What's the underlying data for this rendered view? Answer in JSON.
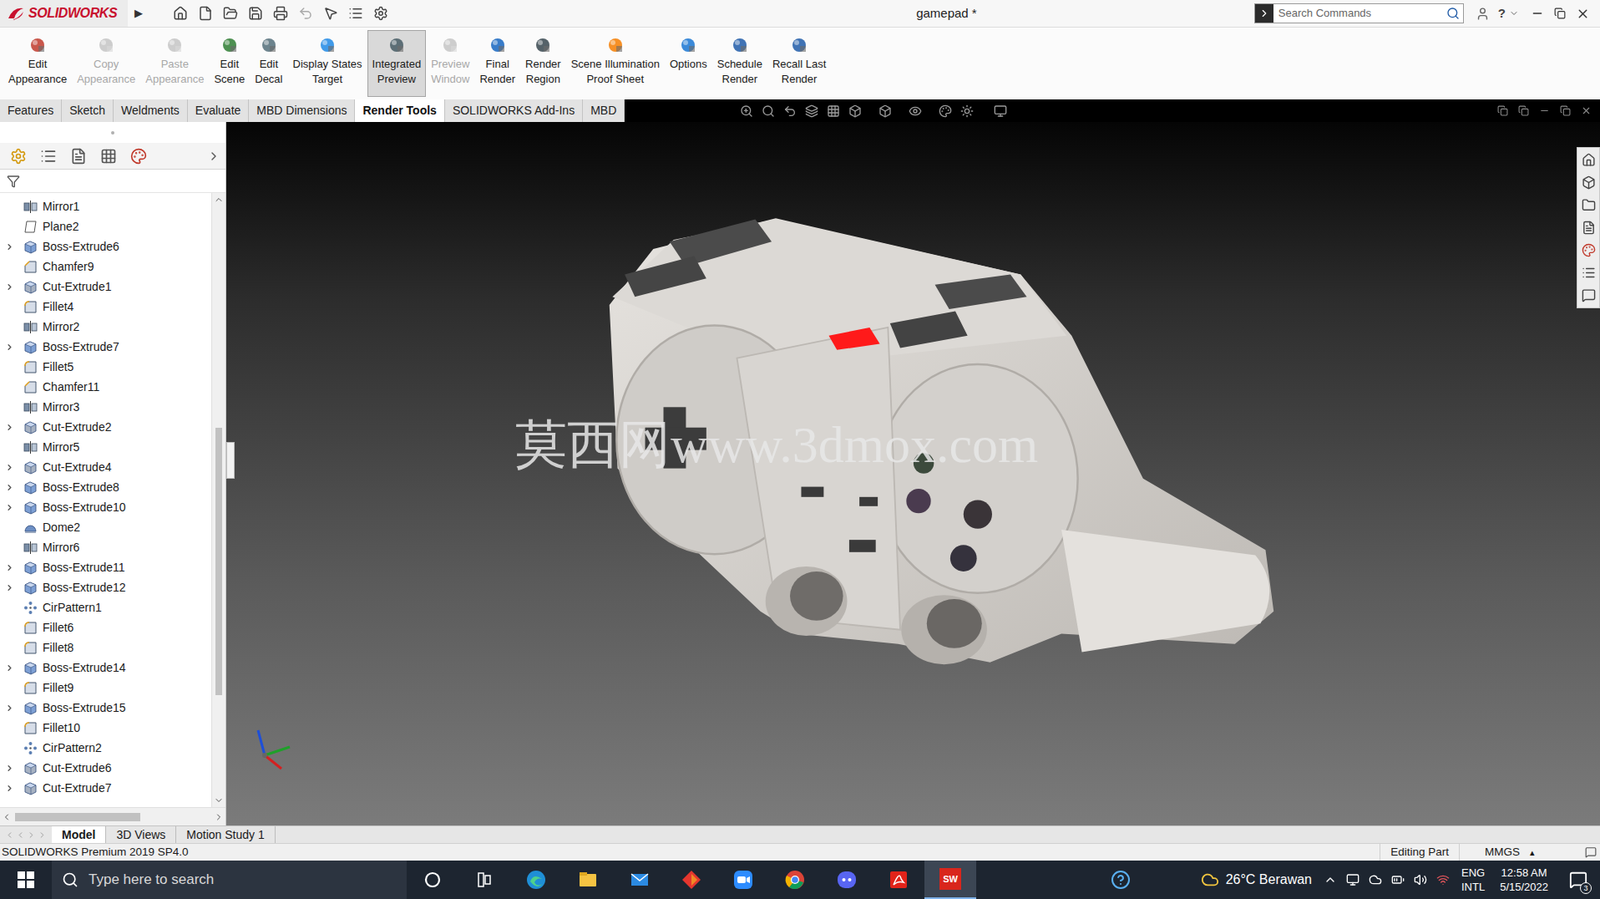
{
  "title_bar": {
    "app": "SOLIDWORKS",
    "arrow": "▶",
    "title": "gamepad *",
    "search_placeholder": "Search Commands",
    "help": "?"
  },
  "ribbon": [
    {
      "lines": [
        "Edit",
        "Appearance"
      ],
      "disabled": false,
      "selected": false
    },
    {
      "lines": [
        "Copy",
        "Appearance"
      ],
      "disabled": true,
      "selected": false
    },
    {
      "lines": [
        "Paste",
        "Appearance"
      ],
      "disabled": true,
      "selected": false
    },
    {
      "lines": [
        "Edit",
        "Scene"
      ],
      "disabled": false,
      "selected": false
    },
    {
      "lines": [
        "Edit",
        "Decal"
      ],
      "disabled": false,
      "selected": false
    },
    {
      "lines": [
        "Display States",
        "Target"
      ],
      "disabled": false,
      "selected": false
    },
    {
      "lines": [
        "Integrated",
        "Preview"
      ],
      "disabled": false,
      "selected": true
    },
    {
      "lines": [
        "Preview",
        "Window"
      ],
      "disabled": true,
      "selected": false
    },
    {
      "lines": [
        "Final",
        "Render"
      ],
      "disabled": false,
      "selected": false
    },
    {
      "lines": [
        "Render",
        "Region"
      ],
      "disabled": false,
      "selected": false
    },
    {
      "lines": [
        "Scene Illumination",
        "Proof Sheet"
      ],
      "disabled": false,
      "selected": false
    },
    {
      "lines": [
        "Options"
      ],
      "disabled": false,
      "selected": false
    },
    {
      "lines": [
        "Schedule",
        "Render"
      ],
      "disabled": false,
      "selected": false
    },
    {
      "lines": [
        "Recall Last",
        "Render"
      ],
      "disabled": false,
      "selected": false
    }
  ],
  "tabs": [
    {
      "label": "Features",
      "selected": false
    },
    {
      "label": "Sketch",
      "selected": false
    },
    {
      "label": "Weldments",
      "selected": false
    },
    {
      "label": "Evaluate",
      "selected": false
    },
    {
      "label": "MBD Dimensions",
      "selected": false
    },
    {
      "label": "Render Tools",
      "selected": true
    },
    {
      "label": "SOLIDWORKS Add-Ins",
      "selected": false
    },
    {
      "label": "MBD",
      "selected": false
    }
  ],
  "feature_tree": {
    "items": [
      {
        "name": "Mirror1",
        "kind": "mirror",
        "expandable": false
      },
      {
        "name": "Plane2",
        "kind": "plane",
        "expandable": false
      },
      {
        "name": "Boss-Extrude6",
        "kind": "boss",
        "expandable": true
      },
      {
        "name": "Chamfer9",
        "kind": "chamfer",
        "expandable": false
      },
      {
        "name": "Cut-Extrude1",
        "kind": "cut",
        "expandable": true
      },
      {
        "name": "Fillet4",
        "kind": "fillet",
        "expandable": false
      },
      {
        "name": "Mirror2",
        "kind": "mirror",
        "expandable": false
      },
      {
        "name": "Boss-Extrude7",
        "kind": "boss",
        "expandable": true
      },
      {
        "name": "Fillet5",
        "kind": "fillet",
        "expandable": false
      },
      {
        "name": "Chamfer11",
        "kind": "chamfer",
        "expandable": false
      },
      {
        "name": "Mirror3",
        "kind": "mirror",
        "expandable": false
      },
      {
        "name": "Cut-Extrude2",
        "kind": "cut",
        "expandable": true
      },
      {
        "name": "Mirror5",
        "kind": "mirror",
        "expandable": false
      },
      {
        "name": "Cut-Extrude4",
        "kind": "cut",
        "expandable": true
      },
      {
        "name": "Boss-Extrude8",
        "kind": "boss",
        "expandable": true
      },
      {
        "name": "Boss-Extrude10",
        "kind": "boss",
        "expandable": true
      },
      {
        "name": "Dome2",
        "kind": "dome",
        "expandable": false
      },
      {
        "name": "Mirror6",
        "kind": "mirror",
        "expandable": false
      },
      {
        "name": "Boss-Extrude11",
        "kind": "boss",
        "expandable": true
      },
      {
        "name": "Boss-Extrude12",
        "kind": "boss",
        "expandable": true
      },
      {
        "name": "CirPattern1",
        "kind": "pattern",
        "expandable": false
      },
      {
        "name": "Fillet6",
        "kind": "fillet",
        "expandable": false
      },
      {
        "name": "Fillet8",
        "kind": "fillet",
        "expandable": false
      },
      {
        "name": "Boss-Extrude14",
        "kind": "boss",
        "expandable": true
      },
      {
        "name": "Fillet9",
        "kind": "fillet",
        "expandable": false
      },
      {
        "name": "Boss-Extrude15",
        "kind": "boss",
        "expandable": true
      },
      {
        "name": "Fillet10",
        "kind": "fillet",
        "expandable": false
      },
      {
        "name": "CirPattern2",
        "kind": "pattern",
        "expandable": false
      },
      {
        "name": "Cut-Extrude6",
        "kind": "cut",
        "expandable": true
      },
      {
        "name": "Cut-Extrude7",
        "kind": "cut",
        "expandable": true
      }
    ]
  },
  "viewport": {
    "watermark": "莫西网www.3dmox.com"
  },
  "bottom_tabs": [
    {
      "label": "Model",
      "selected": true
    },
    {
      "label": "3D Views",
      "selected": false
    },
    {
      "label": "Motion Study 1",
      "selected": false
    }
  ],
  "status_bar": {
    "product": "SOLIDWORKS Premium 2019 SP4.0",
    "mode": "Editing Part",
    "units": "MMGS",
    "units_arrow": "▴"
  },
  "taskbar": {
    "search_placeholder": "Type here to search",
    "apps": [
      {
        "kind": "cortana",
        "label": "",
        "selected": false
      },
      {
        "kind": "taskview",
        "label": "",
        "selected": false
      },
      {
        "kind": "edge",
        "label": "",
        "selected": false
      },
      {
        "kind": "explorer",
        "label": "",
        "selected": false
      },
      {
        "kind": "mail",
        "label": "",
        "selected": false
      },
      {
        "kind": "diamond",
        "label": "",
        "selected": false
      },
      {
        "kind": "zoom",
        "label": "",
        "selected": false
      },
      {
        "kind": "chrome",
        "label": "",
        "selected": false
      },
      {
        "kind": "discord",
        "label": "",
        "selected": false
      },
      {
        "kind": "acrobat",
        "label": "",
        "selected": false
      },
      {
        "kind": "solidworks",
        "label": "SW",
        "selected": true
      }
    ],
    "weather": "26°C Berawan",
    "language": [
      "ENG",
      "INTL"
    ],
    "time": "12:58 AM",
    "date": "5/15/2022",
    "notifications": "3"
  }
}
